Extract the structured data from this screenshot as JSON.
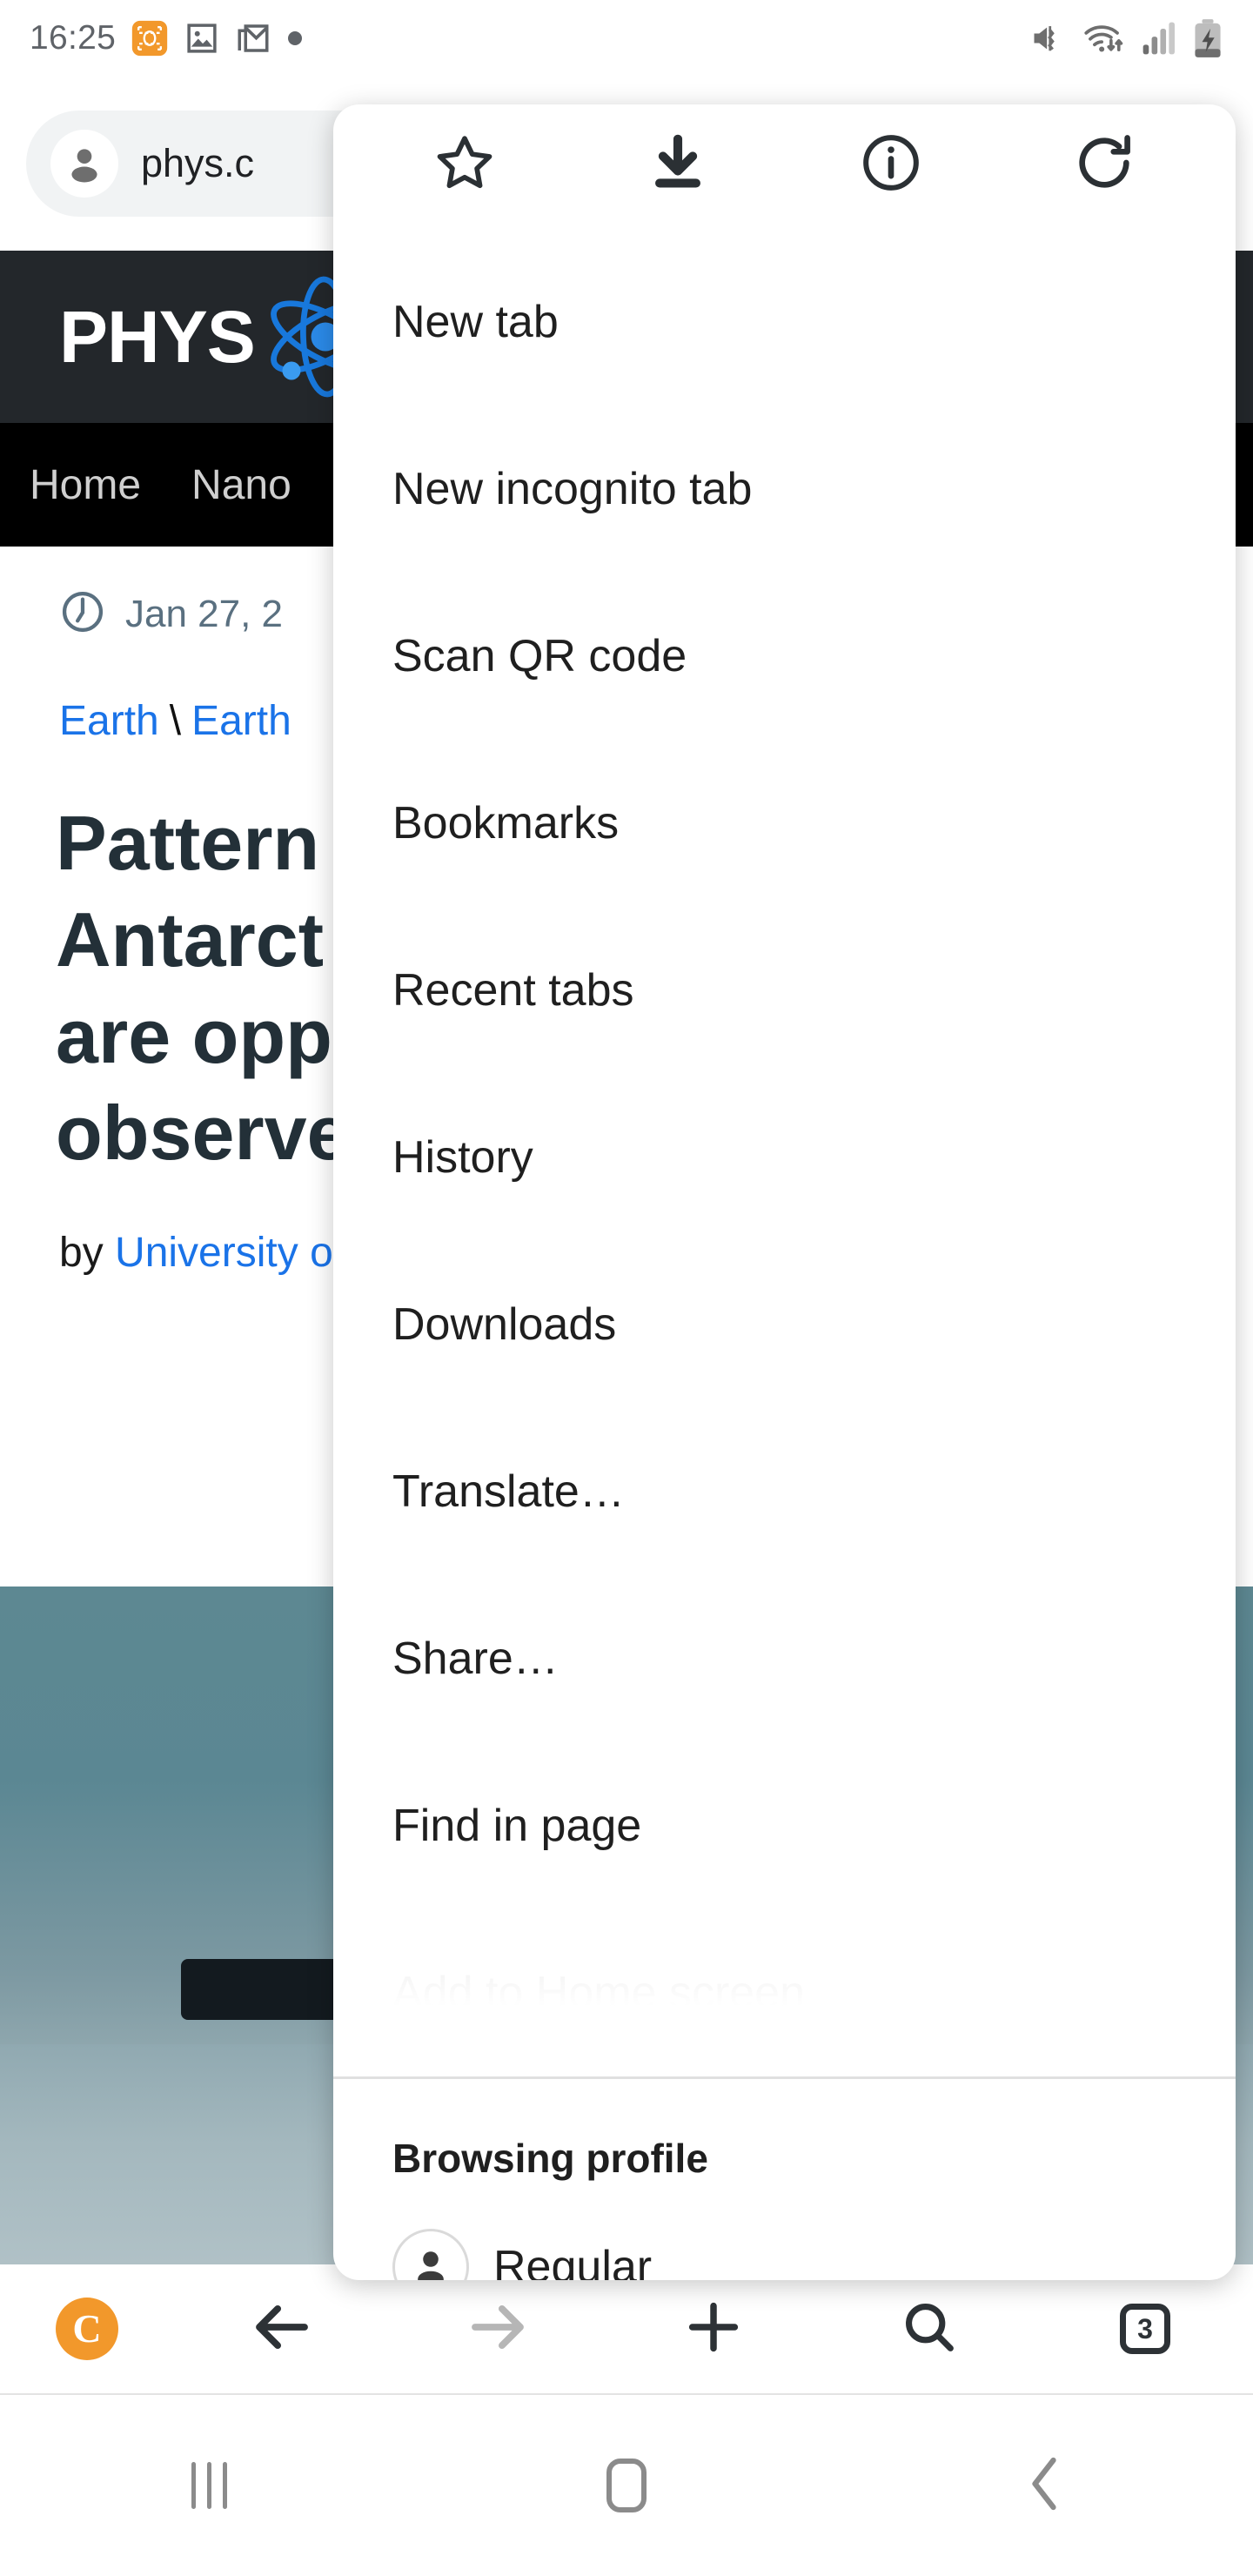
{
  "status_bar": {
    "clock": "16:25",
    "left_icons": [
      "screenshot-capture-icon",
      "image-icon",
      "gmail-icon",
      "more-notifications-dot-icon"
    ],
    "right_icons": [
      "mute-vibrate-icon",
      "wifi-icon",
      "cellular-signal-icon",
      "battery-charging-icon"
    ]
  },
  "omnibox": {
    "url": "phys.c",
    "avatar_icon": "profile-avatar-icon"
  },
  "site": {
    "logo_text": "PHYS",
    "logo_icon": "atom-icon",
    "nav_links": [
      "Home",
      "Nano"
    ],
    "article": {
      "clock_icon": "clock-icon",
      "date": "Jan 27, 2",
      "breadcrumb": [
        {
          "label": "Earth",
          "sep": "\\"
        },
        {
          "label": "Earth",
          "sep": ""
        }
      ],
      "headline_lines": [
        "Pattern",
        "Antarct",
        "are opp",
        "observe"
      ],
      "byline_prefix": "by ",
      "byline_author": "University o",
      "photo_alt": "antarctic-tracked-vehicle-photo"
    }
  },
  "menu": {
    "header_actions": [
      {
        "name": "bookmark-star-icon",
        "label": "Bookmark"
      },
      {
        "name": "download-icon",
        "label": "Download"
      },
      {
        "name": "page-info-icon",
        "label": "Page info"
      },
      {
        "name": "reload-icon",
        "label": "Reload"
      }
    ],
    "items": [
      {
        "label": "New tab",
        "faded": false
      },
      {
        "label": "New incognito tab",
        "faded": false
      },
      {
        "label": "Scan QR code",
        "faded": false
      },
      {
        "label": "Bookmarks",
        "faded": false
      },
      {
        "label": "Recent tabs",
        "faded": false
      },
      {
        "label": "History",
        "faded": false
      },
      {
        "label": "Downloads",
        "faded": false
      },
      {
        "label": "Translate…",
        "faded": false
      },
      {
        "label": "Share…",
        "faded": false
      },
      {
        "label": "Find in page",
        "faded": false
      },
      {
        "label": "Add to Home screen",
        "faded": true
      }
    ],
    "profile": {
      "section_label": "Browsing profile",
      "avatar_icon": "profile-avatar-icon",
      "name": "Regular"
    }
  },
  "browser_toolbar": {
    "logo_letter": "C",
    "buttons": [
      {
        "name": "back-arrow-icon",
        "label": "Back",
        "enabled": true
      },
      {
        "name": "forward-arrow-icon",
        "label": "Forward",
        "enabled": false
      },
      {
        "name": "new-tab-plus-icon",
        "label": "New tab",
        "enabled": true
      },
      {
        "name": "search-icon",
        "label": "Search",
        "enabled": true
      }
    ],
    "tab_count": "3"
  },
  "android_nav": {
    "recents_label": "Recents",
    "home_label": "Home",
    "back_label": "Back"
  },
  "colors": {
    "accent_blue": "#1a73e8",
    "brand_orange": "#f2982b",
    "menu_bg": "#ffffff",
    "site_header_bg": "#23272b",
    "site_nav_bg": "#000000"
  }
}
